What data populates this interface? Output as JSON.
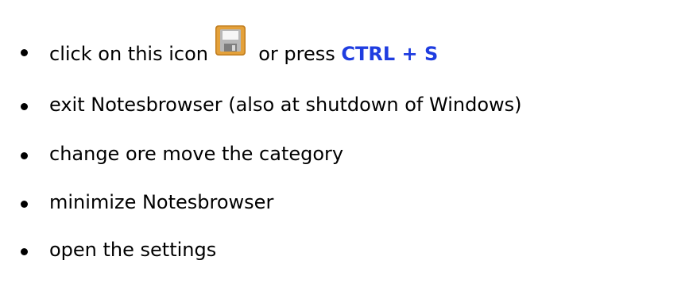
{
  "colors": {
    "text": "#000000",
    "shortcut": "#1f3de0",
    "icon_frame": "#e4a13a",
    "icon_frame_dark": "#c07c1d",
    "icon_body": "#b8b8b8",
    "icon_label": "#f6f6f6",
    "icon_shutter": "#7e7e7e"
  },
  "icons": {
    "save": "floppy-disk-save-icon"
  },
  "items": [
    {
      "before_icon": "click on this icon",
      "after_icon": "or press",
      "shortcut": "CTRL + S"
    },
    {
      "text": "exit Notesbrowser (also at shutdown of Windows)"
    },
    {
      "text": "change ore move the category"
    },
    {
      "text": "minimize Notesbrowser"
    },
    {
      "text": "open the settings"
    }
  ]
}
